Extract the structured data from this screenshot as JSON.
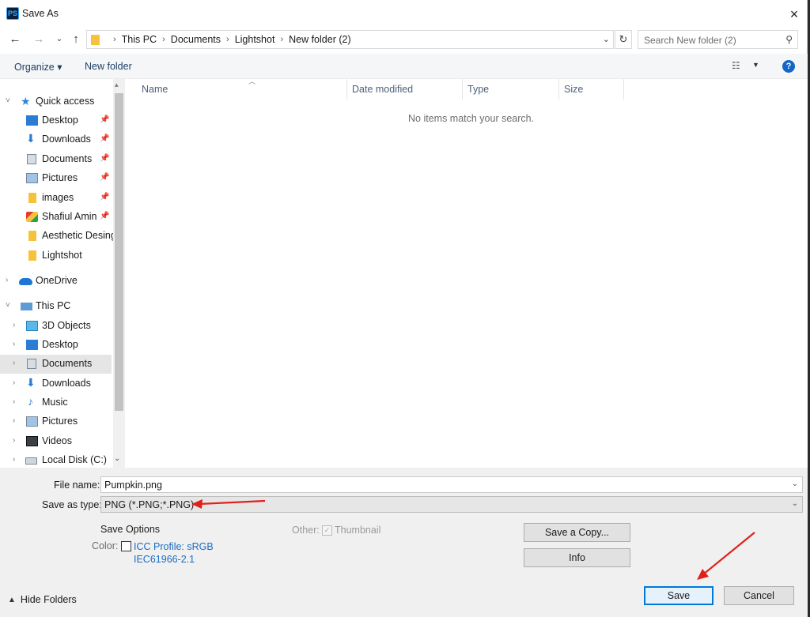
{
  "window": {
    "app_icon": "PS",
    "title": "Save As",
    "close_icon": "×"
  },
  "address": {
    "crumbs": [
      "This PC",
      "Documents",
      "Lightshot",
      "New folder (2)"
    ],
    "search_placeholder": "Search New folder (2)"
  },
  "toolbar": {
    "organize_label": "Organize ▾",
    "new_folder_label": "New folder",
    "help_label": "?"
  },
  "nav": {
    "items": [
      {
        "label": "Quick access",
        "icon": "star-icon"
      },
      {
        "label": "Desktop",
        "icon": "desktop-icon",
        "pinned": true
      },
      {
        "label": "Downloads",
        "icon": "download-icon",
        "pinned": true
      },
      {
        "label": "Documents",
        "icon": "documents-icon",
        "pinned": true
      },
      {
        "label": "Pictures",
        "icon": "pictures-icon",
        "pinned": true
      },
      {
        "label": "images",
        "icon": "folder-icon",
        "pinned": true
      },
      {
        "label": "Shafiul Amin",
        "icon": "user-folder-icon",
        "pinned": true
      },
      {
        "label": "Aesthetic Desing",
        "icon": "folder-icon"
      },
      {
        "label": "Lightshot",
        "icon": "folder-icon"
      },
      {
        "label": "OneDrive",
        "icon": "cloud-icon"
      },
      {
        "label": "This PC",
        "icon": "computer-icon"
      },
      {
        "label": "3D Objects",
        "icon": "cube-icon"
      },
      {
        "label": "Desktop",
        "icon": "desktop-icon"
      },
      {
        "label": "Documents",
        "icon": "documents-icon",
        "selected": true
      },
      {
        "label": "Downloads",
        "icon": "download-icon"
      },
      {
        "label": "Music",
        "icon": "music-icon"
      },
      {
        "label": "Pictures",
        "icon": "pictures-icon"
      },
      {
        "label": "Videos",
        "icon": "video-icon"
      },
      {
        "label": "Local Disk (C:)",
        "icon": "disk-icon"
      }
    ]
  },
  "filelist": {
    "columns": [
      "Name",
      "Date modified",
      "Type",
      "Size"
    ],
    "empty_message": "No items match your search."
  },
  "form": {
    "file_name_label": "File name:",
    "file_name_value": "Pumpkin.png",
    "save_type_label": "Save as type:",
    "save_type_value": "PNG (*.PNG;*.PNG)",
    "save_options_label": "Save Options",
    "color_label": "Color:",
    "icc_line1": "ICC Profile:  sRGB",
    "icc_line2": "IEC61966-2.1",
    "other_label": "Other:",
    "thumbnail_label": "Thumbnail",
    "save_copy_label": "Save a Copy...",
    "info_label": "Info",
    "save_label": "Save",
    "cancel_label": "Cancel",
    "hide_folders_label": "Hide Folders"
  },
  "colors": {
    "accent": "#0078d7",
    "annotation_arrow": "#e0211b",
    "link": "#1a6cc0"
  }
}
